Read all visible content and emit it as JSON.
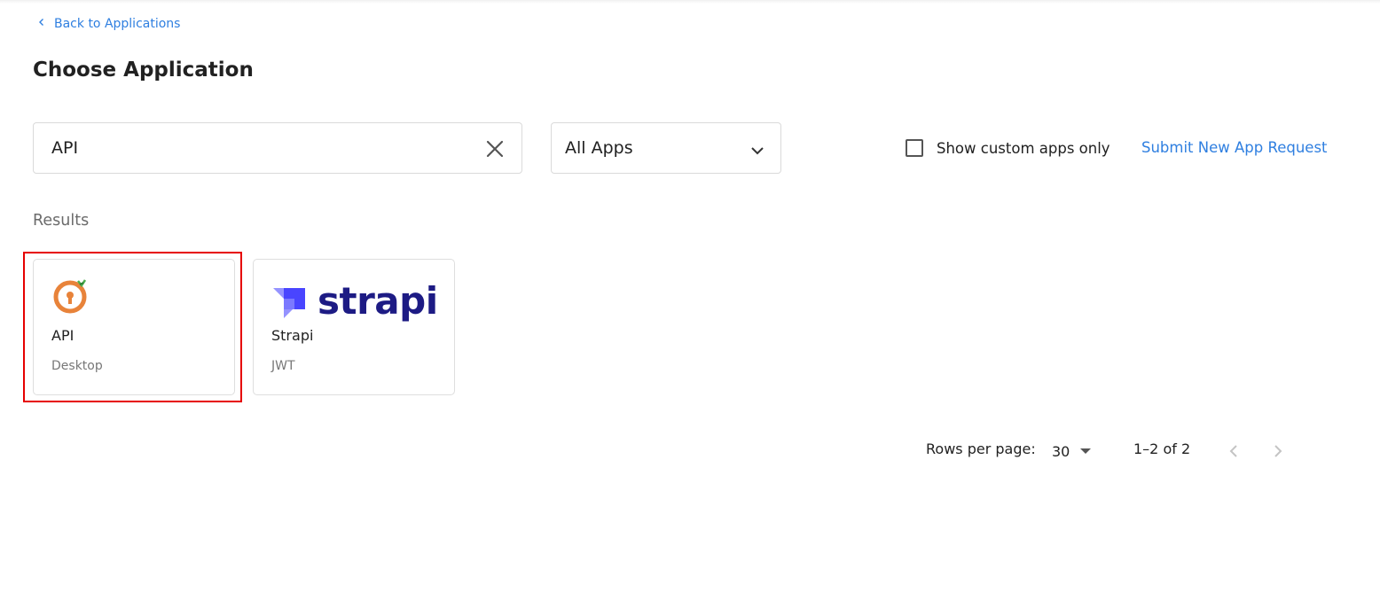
{
  "nav": {
    "back_label": "Back to Applications"
  },
  "header": {
    "title": "Choose Application"
  },
  "filters": {
    "search_value": "API",
    "app_filter_value": "All Apps",
    "custom_only_label": "Show custom apps only",
    "custom_only_checked": false,
    "submit_request_label": "Submit New App Request"
  },
  "results": {
    "label": "Results",
    "cards": [
      {
        "name": "API",
        "type": "Desktop",
        "logo": "orange-keyhole-icon",
        "selected": true
      },
      {
        "name": "Strapi",
        "type": "JWT",
        "logo": "strapi-logo",
        "logo_text": "strapi"
      }
    ]
  },
  "pagination": {
    "rows_label": "Rows per page:",
    "rows_value": "30",
    "range": "1–2 of 2"
  },
  "colors": {
    "accent": "#2f7fe0",
    "highlight": "#e60000",
    "strapi_brand": "#1d1b84",
    "api_logo": "#e8833a"
  }
}
